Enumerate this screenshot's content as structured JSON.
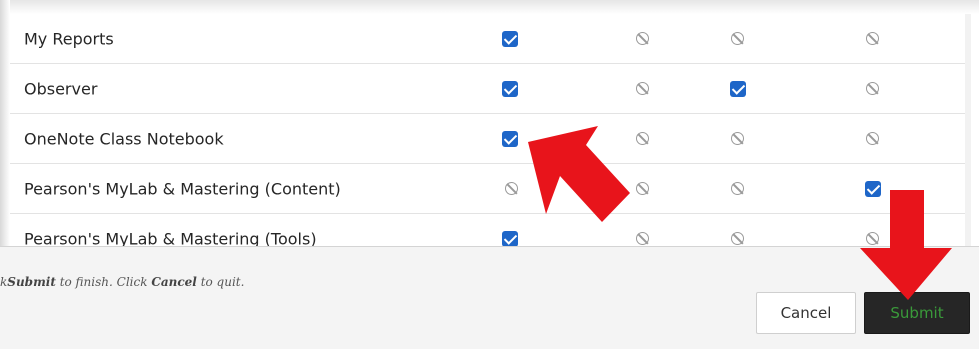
{
  "rows": [
    {
      "name": "My Reports",
      "cells": [
        "check",
        "blocked",
        "blocked",
        "blocked"
      ]
    },
    {
      "name": "Observer",
      "cells": [
        "check",
        "blocked",
        "check",
        "blocked"
      ]
    },
    {
      "name": "OneNote Class Notebook",
      "cells": [
        "check",
        "blocked",
        "blocked",
        "blocked"
      ]
    },
    {
      "name": "Pearson's MyLab & Mastering (Content)",
      "cells": [
        "blocked",
        "blocked",
        "blocked",
        "check"
      ]
    },
    {
      "name": "Pearson's MyLab & Mastering (Tools)",
      "cells": [
        "check",
        "blocked",
        "blocked",
        "blocked"
      ]
    }
  ],
  "footer": {
    "instruction_prefix": "k",
    "instruction_submit": "Submit",
    "instruction_mid": " to finish. Click ",
    "instruction_cancel": "Cancel",
    "instruction_suffix": " to quit."
  },
  "buttons": {
    "cancel_label": "Cancel",
    "submit_label": "Submit"
  },
  "colors": {
    "checkbox": "#1e66c8",
    "arrow": "#e8141b",
    "submit_bg": "#262626",
    "submit_text": "#3a9a3a"
  },
  "icons": {
    "checked": "checkbox-checked-icon",
    "blocked": "not-allowed-icon"
  }
}
